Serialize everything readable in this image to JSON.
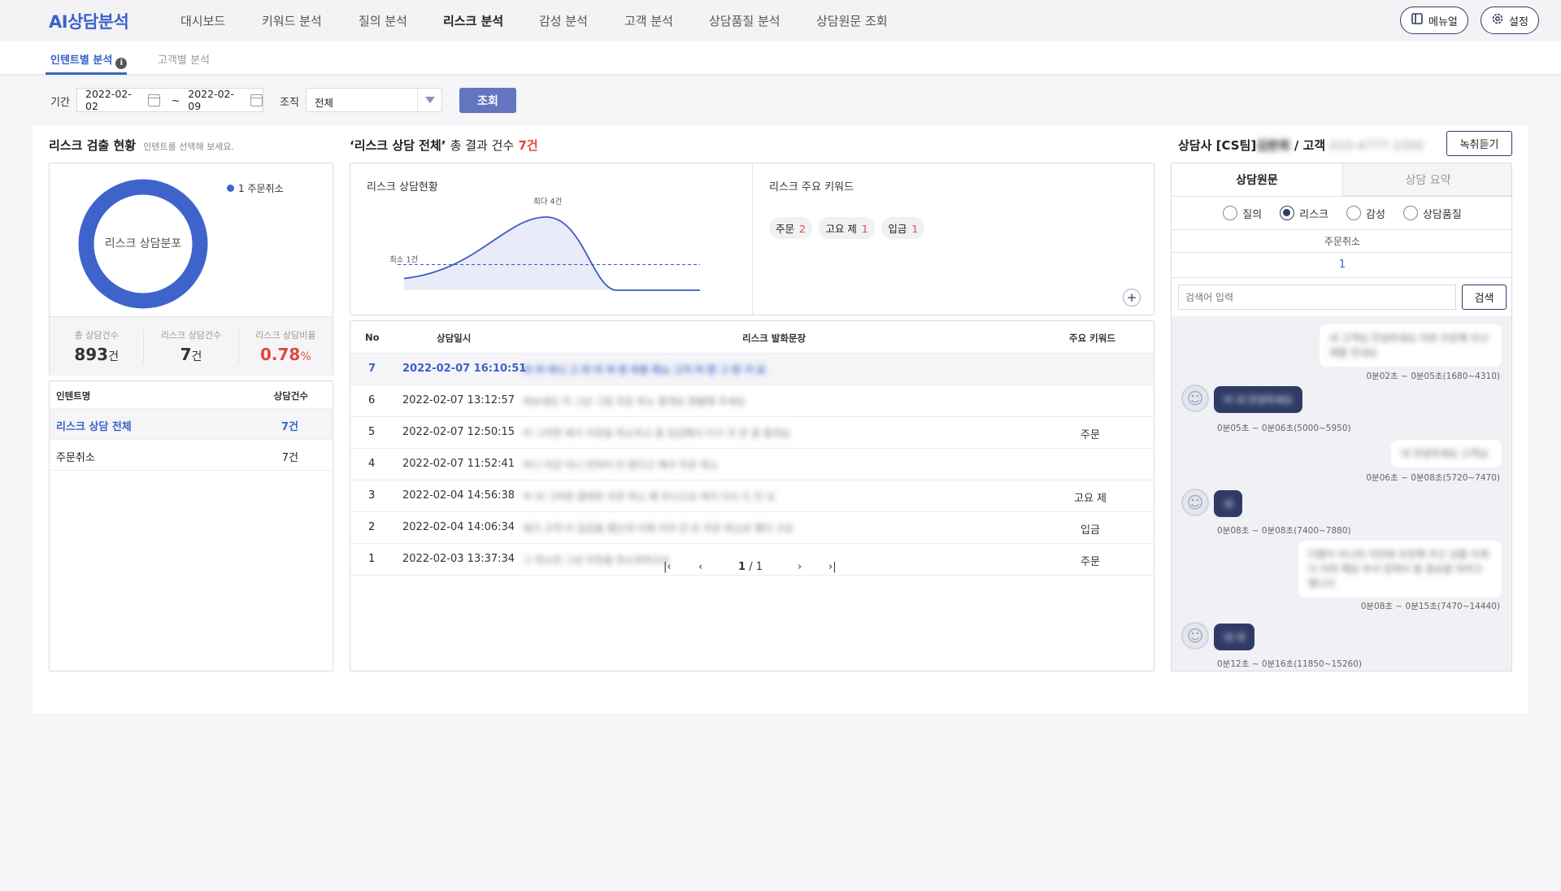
{
  "app": {
    "logo": "AI상담분석"
  },
  "nav": {
    "items": [
      "대시보드",
      "키워드 분석",
      "질의 분석",
      "리스크 분석",
      "감성 분석",
      "고객 분석",
      "상담품질 분석",
      "상담원문 조회"
    ],
    "active": "리스크 분석",
    "manual_label": "메뉴얼",
    "settings_label": "설정"
  },
  "subtabs": {
    "items": [
      "인텐트별 분석",
      "고객별 분석"
    ],
    "active": "인텐트별 분석"
  },
  "filter": {
    "period_label": "기간",
    "date_from": "2022-02-02",
    "date_sep": "~",
    "date_to": "2022-02-09",
    "org_label": "조직",
    "org_value": "전체",
    "query_button": "조회"
  },
  "left": {
    "title": "리스크 검출 현황",
    "hint": "인텐트를 선택해 보세요.",
    "donut_center": "리스크 상담분포",
    "legend": [
      {
        "label": "1 주문취소",
        "color": "#3e64cc"
      }
    ],
    "stats": [
      {
        "label": "총 상담건수",
        "value": "893",
        "unit": "건"
      },
      {
        "label": "리스크 상담건수",
        "value": "7",
        "unit": "건"
      },
      {
        "label": "리스크 상담비율",
        "value": "0.78",
        "unit": "%"
      }
    ],
    "table": {
      "headers": [
        "인텐트명",
        "상담건수"
      ],
      "rows": [
        {
          "name": "리스크 상담 전체",
          "count": "7건"
        },
        {
          "name": "주문취소",
          "count": "7건"
        }
      ]
    }
  },
  "middle": {
    "title_quote": "‘리스크 상담 전체’",
    "title_rest": "총 결과 건수",
    "title_count": "7건",
    "chart_title": "리스크 상담현황",
    "keywords_title": "리스크 주요 키워드",
    "keywords": [
      {
        "word": "주문",
        "count": "2"
      },
      {
        "word": "고요 제",
        "count": "1"
      },
      {
        "word": "입금",
        "count": "1"
      }
    ],
    "chart_data": {
      "type": "area",
      "title": "리스크 상담현황",
      "annotations": {
        "max_label": "최다 4건",
        "min_label": "최소 1건"
      },
      "values": [
        1,
        2,
        4,
        0,
        0
      ],
      "avg_line": 1.4,
      "colors": {
        "line": "#3a5bc7",
        "fill": "#e9ecf8",
        "avg": "#3a5bc7"
      }
    },
    "table": {
      "headers": [
        "No",
        "상담일시",
        "리스크 발화문장",
        "주요 키워드"
      ],
      "rows": [
        {
          "no": "7",
          "datetime": "2022-02-07 16:10:51",
          "sentence": "아 아 아니 그 저 아 저 번 주문 취소 그거 아 한 그 번 거 요",
          "keyword": "",
          "highlight": true
        },
        {
          "no": "6",
          "datetime": "2022-02-07 13:12:57",
          "sentence": "여보세요 저 그냥 그럼 주문 취소 할게요 환불해 주세요",
          "keyword": ""
        },
        {
          "no": "5",
          "datetime": "2022-02-07 12:50:15",
          "sentence": "아 그러면 제가 주문을 취소하고 좀 입금해서 다시 주 문 좀 할게요",
          "keyword": "주문"
        },
        {
          "no": "4",
          "datetime": "2022-02-07 11:52:41",
          "sentence": "아니 지금 아니 전부터 안 왔다고 해서 주문 취소",
          "keyword": ""
        },
        {
          "no": "3",
          "datetime": "2022-02-04 14:56:38",
          "sentence": "아 네 그러면 결제한 주문 취소 해 주시고요 제가 다시 드 린 요",
          "keyword": "고요 제"
        },
        {
          "no": "2",
          "datetime": "2022-02-04 14:06:34",
          "sentence": "제가 고객 이 입금을 했는데 이제 아직 안 온 주문 취소로 했다 고요",
          "keyword": "입금"
        },
        {
          "no": "1",
          "datetime": "2022-02-03 13:37:34",
          "sentence": "그 취소한 그냥 주문을 취소하려고요",
          "keyword": "주문"
        }
      ]
    },
    "pagination": {
      "current": "1",
      "sep": "/",
      "total": "1"
    }
  },
  "right": {
    "title_prefix": "상담사 [CS팀]",
    "agent_name": "김판희",
    "title_mid": "/ 고객",
    "customer_id": "010-4777-1000",
    "listen_button": "녹취듣기",
    "tabs": [
      "상담원문",
      "상담 요약"
    ],
    "active_tab": "상담원문",
    "radios": [
      "질의",
      "리스크",
      "감성",
      "상담품질"
    ],
    "radio_selected": "리스크",
    "intent_header": "주문취소",
    "intent_count": "1",
    "search_placeholder": "검색어 입력",
    "search_button": "검색",
    "messages": [
      {
        "side": "right",
        "text": "네 고객님 안녕하세요 저희 주문해 주신 제품 안내요",
        "time": "0분02초 ~ 0분05초(1680~4310)"
      },
      {
        "side": "left",
        "text": "아 네 안녕하세요",
        "time": "0분05초 ~ 0분06초(5000~5950)"
      },
      {
        "side": "right",
        "text": "네 안녕하세요 고객님",
        "time": "0분06초 ~ 0분08초(5720~7470)"
      },
      {
        "side": "left",
        "text": "네",
        "time": "0분08초 ~ 0분08초(7400~7880)"
      },
      {
        "side": "right",
        "text": "다름이 아니라 이번에 주문해 주신 상품 이제 이 저희 해당 부서 입력이 좀 필요할 하려고 했니다",
        "time": "0분08초 ~ 0분15초(7470~14440)"
      },
      {
        "side": "left",
        "text": "네 네",
        "time": "0분12초 ~ 0분16초(11850~15260)"
      }
    ]
  }
}
